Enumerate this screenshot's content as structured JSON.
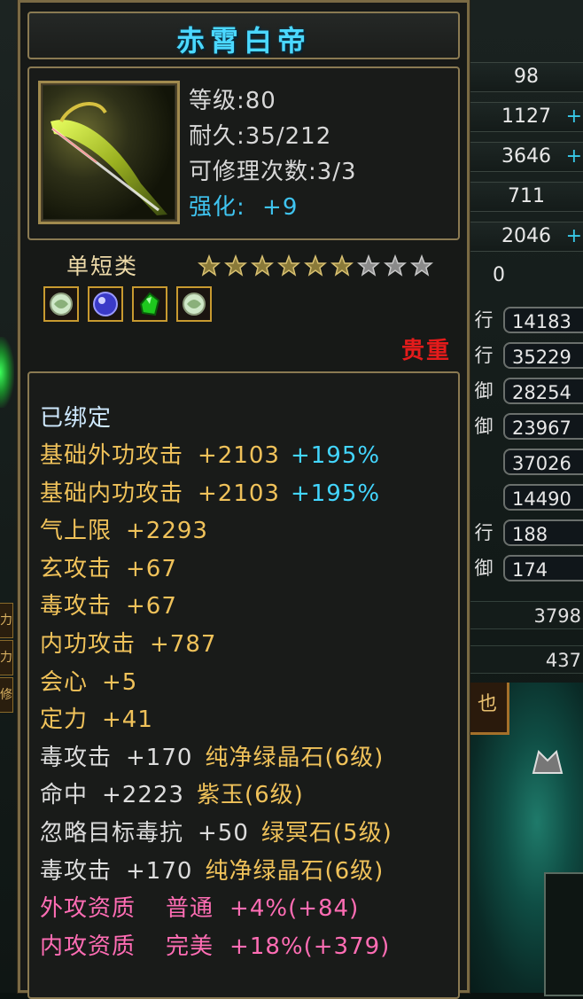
{
  "background": {
    "stat_values": [
      "98",
      "1127",
      "3646",
      "711",
      "2046",
      "0"
    ],
    "stat_mark": "+",
    "attr_labels": [
      "行",
      "行",
      "御",
      "御",
      "",
      "",
      "行",
      "御"
    ],
    "attr_values": [
      "14183",
      "35229",
      "28254",
      "23967",
      "37026",
      "14490",
      "188",
      "174"
    ],
    "wide_values": [
      "3798",
      "437"
    ],
    "left_tab_labels": [
      "力",
      "力",
      "修"
    ],
    "scene_label": "也"
  },
  "item": {
    "name": "赤霄白帝",
    "level_text": "等级:80",
    "durability_text": "耐久:35/212",
    "repair_text": "可修理次数:3/3",
    "enhance_label": "强化:",
    "enhance_value": "+9",
    "category": "单短类",
    "stars_filled": 6,
    "stars_total": 9,
    "rarity": "贵重",
    "sockets": [
      "white-jade-gem-icon",
      "blue-gem-icon",
      "green-gem-icon",
      "white-jade-gem-icon"
    ],
    "bound_text": "已绑定",
    "attributes": [
      {
        "label": "基础外功攻击",
        "value": "+2103",
        "extra": "+195%",
        "color": "gold",
        "extra_color": "cyan"
      },
      {
        "label": "基础内功攻击",
        "value": "+2103",
        "extra": "+195%",
        "color": "gold",
        "extra_color": "cyan"
      },
      {
        "label": "气上限",
        "value": "+2293",
        "extra": "",
        "color": "gold"
      },
      {
        "label": "玄攻击",
        "value": "+67",
        "extra": "",
        "color": "gold"
      },
      {
        "label": "毒攻击",
        "value": "+67",
        "extra": "",
        "color": "gold"
      },
      {
        "label": "内功攻击",
        "value": "+787",
        "extra": "",
        "color": "gold"
      },
      {
        "label": "会心",
        "value": "+5",
        "extra": "",
        "color": "gold"
      },
      {
        "label": "定力",
        "value": "+41",
        "extra": "",
        "color": "gold"
      }
    ],
    "gem_lines": [
      {
        "label": "毒攻击",
        "value": "+170",
        "gem": "纯净绿晶石(6级)"
      },
      {
        "label": "命中",
        "value": "+2223",
        "gem": "紫玉(6级)"
      },
      {
        "label": "忽略目标毒抗",
        "value": "+50",
        "gem": "绿冥石(5级)"
      },
      {
        "label": "毒攻击",
        "value": "+170",
        "gem": "纯净绿晶石(6级)"
      }
    ],
    "quality_lines": [
      {
        "label": "外攻资质",
        "grade": "普通",
        "value": "+4%(+84)"
      },
      {
        "label": "内攻资质",
        "grade": "完美",
        "value": "+18%(+379)"
      }
    ],
    "colors": {
      "title": "#4bd8ff",
      "gold": "#f0c25a",
      "cyan": "#43d6ff",
      "pink": "#ff6db4",
      "rarity": "#e41b1b",
      "white": "#dcdcdc"
    }
  }
}
